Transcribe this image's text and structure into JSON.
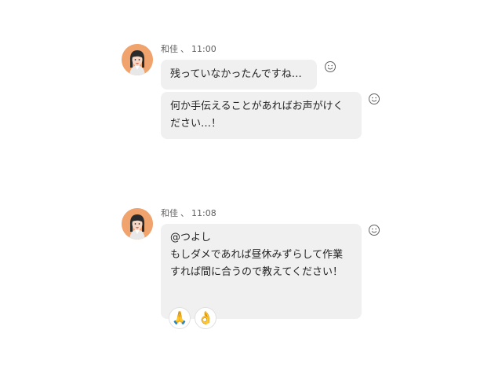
{
  "messages": [
    {
      "sender": "和佳",
      "separator": "、",
      "time": "11:00",
      "bubbles": [
        "残っていなかったんですね…",
        "何か手伝えることがあればお声がけください…！"
      ]
    },
    {
      "sender": "和佳",
      "separator": "、",
      "time": "11:08",
      "bubbles": [
        "@つよし\nもしダメであれば昼休みずらして作業すれば間に合うので教えてください！"
      ],
      "reactions": [
        {
          "emoji": "🙏",
          "icon": "folded-hands-icon"
        },
        {
          "emoji": "👌",
          "icon": "ok-hand-icon"
        }
      ]
    }
  ],
  "icons": {
    "add_reaction": "smiley-icon"
  }
}
